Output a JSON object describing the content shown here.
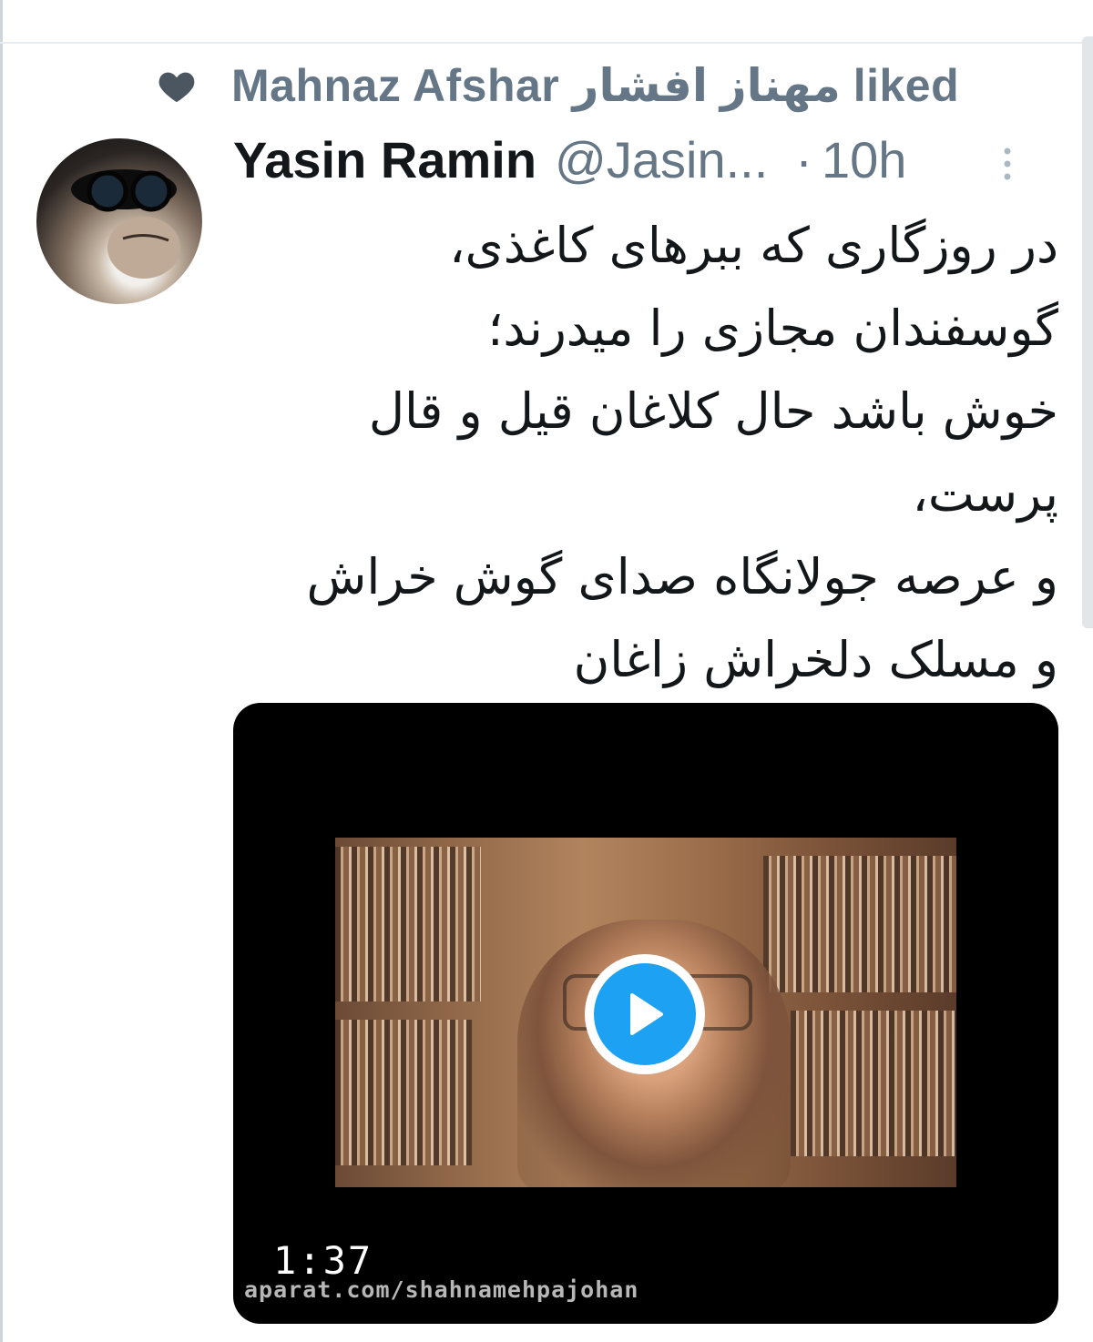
{
  "social_context": {
    "liker_name": "Mahnaz Afshar مهناز افشار",
    "action": "liked",
    "icon": "heart-icon"
  },
  "tweet": {
    "author_name": "Yasin Ramin",
    "author_handle": "@Jasin...",
    "separator": "·",
    "time": "10h",
    "lines": [
      "در روزگاری که ببرهای کاغذی،",
      "گوسفندان مجازی را میدرند؛",
      "خوش باشد حال کلاغان قیل و قال",
      "پرست،",
      "و عرصه جولانگاه صدای گوش خراش",
      "و مسلک دلخراش زاغان"
    ],
    "media": {
      "type": "video",
      "duration": "1:37",
      "watermark": "aparat.com/shahnamehpajohan"
    }
  },
  "colors": {
    "secondary_text": "#657786",
    "primary_text": "#14171a",
    "play_blue": "#1da1f2"
  }
}
